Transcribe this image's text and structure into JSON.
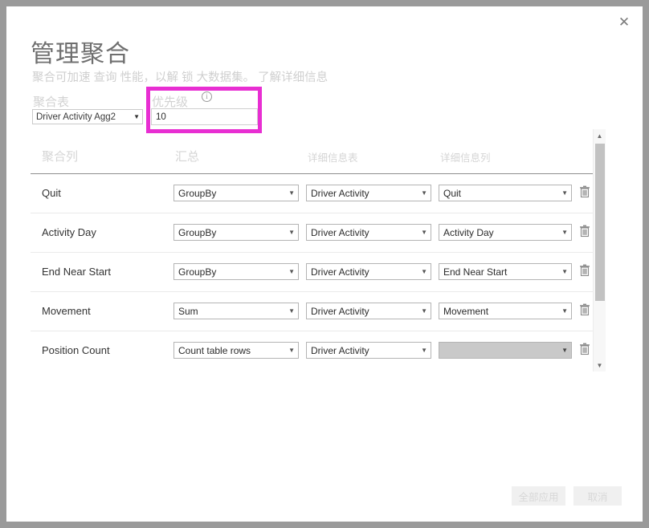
{
  "dialog": {
    "title": "管理聚合",
    "subtitle_prefix": "聚合可加速",
    "subtitle_link1": "查询",
    "subtitle_middle": "性能，以解",
    "subtitle_link2": "锁",
    "subtitle_suffix": "大数据集。",
    "subtitle_learn_more": "了解详细信息",
    "subtitle_full": "聚合可加速 查询性能，以解 锁大数据集。了解详细信息",
    "close_icon": "close-icon"
  },
  "fields": {
    "agg_table_label": "聚合表",
    "agg_table_value": "Driver Activity Agg2",
    "priority_label": "优先级",
    "priority_value": "10",
    "priority_placeholder": "",
    "info_icon_glyph": "i",
    "caret_glyph": "▼"
  },
  "highlight": {
    "color": "#e82ed2",
    "target": "priority-field"
  },
  "table": {
    "headers": [
      "聚合列",
      "汇总",
      "详细信息表",
      "详细信息列"
    ],
    "rows": [
      {
        "agg_column": "Quit",
        "summarization": "GroupBy",
        "detail_table": "Driver Activity",
        "detail_column": "Quit",
        "detail_column_disabled": false
      },
      {
        "agg_column": "Activity Day",
        "summarization": "GroupBy",
        "detail_table": "Driver Activity",
        "detail_column": "Activity Day",
        "detail_column_disabled": false
      },
      {
        "agg_column": "End Near Start",
        "summarization": "GroupBy",
        "detail_table": "Driver Activity",
        "detail_column": "End Near Start",
        "detail_column_disabled": false
      },
      {
        "agg_column": "Movement",
        "summarization": "Sum",
        "detail_table": "Driver Activity",
        "detail_column": "Movement",
        "detail_column_disabled": false
      },
      {
        "agg_column": "Position Count",
        "summarization": "Count table rows",
        "detail_table": "Driver Activity",
        "detail_column": "",
        "detail_column_disabled": true
      }
    ],
    "delete_icon": "trash-icon",
    "scrollbar": {
      "up_glyph": "▲",
      "down_glyph": "▼"
    }
  },
  "footer": {
    "apply_all_label": "全部应用",
    "cancel_label": "取消"
  }
}
